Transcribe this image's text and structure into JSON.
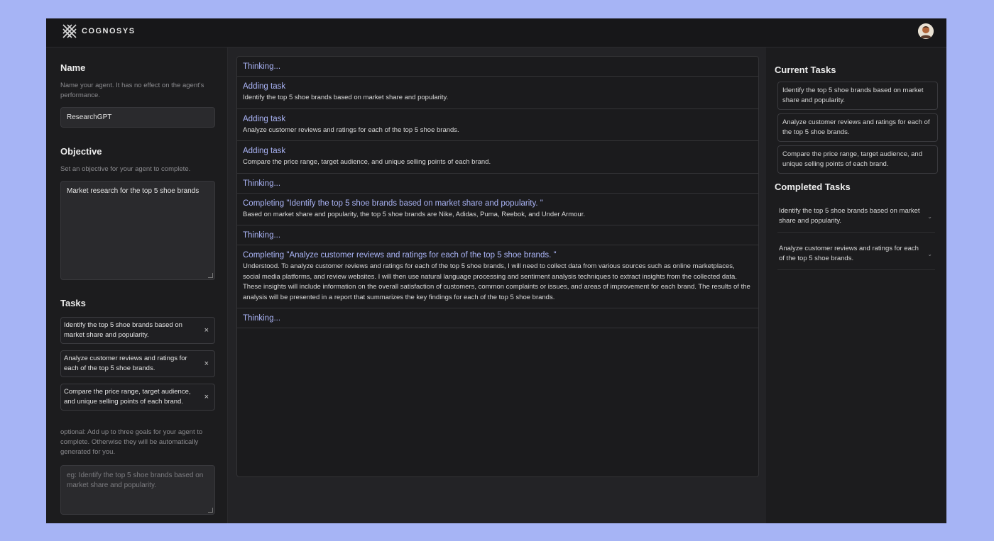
{
  "app": {
    "brand": "COGNOSYS"
  },
  "left": {
    "name_title": "Name",
    "name_help": "Name your agent. It has no effect on the agent's performance.",
    "name_value": "ResearchGPT",
    "objective_title": "Objective",
    "objective_help": "Set an objective for your agent to complete.",
    "objective_value": "Market research for the top 5 shoe brands",
    "tasks_title": "Tasks",
    "tasks": [
      {
        "text": "Identify the top 5 shoe brands based on market share and popularity."
      },
      {
        "text": "Analyze customer reviews and ratings for each of the top 5 shoe brands."
      },
      {
        "text": "Compare the price range, target audience, and unique selling points of each brand."
      }
    ],
    "remove_glyph": "×",
    "optional_help": "optional: Add up to three goals for your agent to complete. Otherwise they will be automatically generated for you.",
    "goal_placeholder": "eg: Identify the top 5 shoe brands based on market share and popularity."
  },
  "log": [
    {
      "head": "Thinking...",
      "body": ""
    },
    {
      "head": "Adding task",
      "body": "Identify the top 5 shoe brands based on market share and popularity."
    },
    {
      "head": "Adding task",
      "body": "Analyze customer reviews and ratings for each of the top 5 shoe brands."
    },
    {
      "head": "Adding task",
      "body": "Compare the price range, target audience, and unique selling points of each brand."
    },
    {
      "head": "Thinking...",
      "body": ""
    },
    {
      "head": "Completing \"Identify the top 5 shoe brands based on market share and popularity. \"",
      "body": "Based on market share and popularity, the top 5 shoe brands are Nike, Adidas, Puma, Reebok, and Under Armour."
    },
    {
      "head": "Thinking...",
      "body": ""
    },
    {
      "head": "Completing \"Analyze customer reviews and ratings for each of the top 5 shoe brands. \"",
      "body": "Understood. To analyze customer reviews and ratings for each of the top 5 shoe brands, I will need to collect data from various sources such as online marketplaces, social media platforms, and review websites. I will then use natural language processing and sentiment analysis techniques to extract insights from the collected data. These insights will include information on the overall satisfaction of customers, common complaints or issues, and areas of improvement for each brand. The results of the analysis will be presented in a report that summarizes the key findings for each of the top 5 shoe brands."
    },
    {
      "head": "Thinking...",
      "body": ""
    }
  ],
  "right": {
    "current_title": "Current Tasks",
    "current": [
      "Identify the top 5 shoe brands based on market share and popularity.",
      "Analyze customer reviews and ratings for each of the top 5 shoe brands.",
      "Compare the price range, target audience, and unique selling points of each brand."
    ],
    "completed_title": "Completed Tasks",
    "completed": [
      "Identify the top 5 shoe brands based on market share and popularity.",
      "Analyze customer reviews and ratings for each of the top 5 shoe brands."
    ]
  },
  "colors": {
    "accent": "#aab4f6",
    "background": "#a6b4f5",
    "panel": "#1c1c1e"
  },
  "icons": {
    "logo": "cognosys-logo-icon",
    "avatar": "user-avatar",
    "remove": "close-icon",
    "expand": "chevron-down-icon"
  }
}
